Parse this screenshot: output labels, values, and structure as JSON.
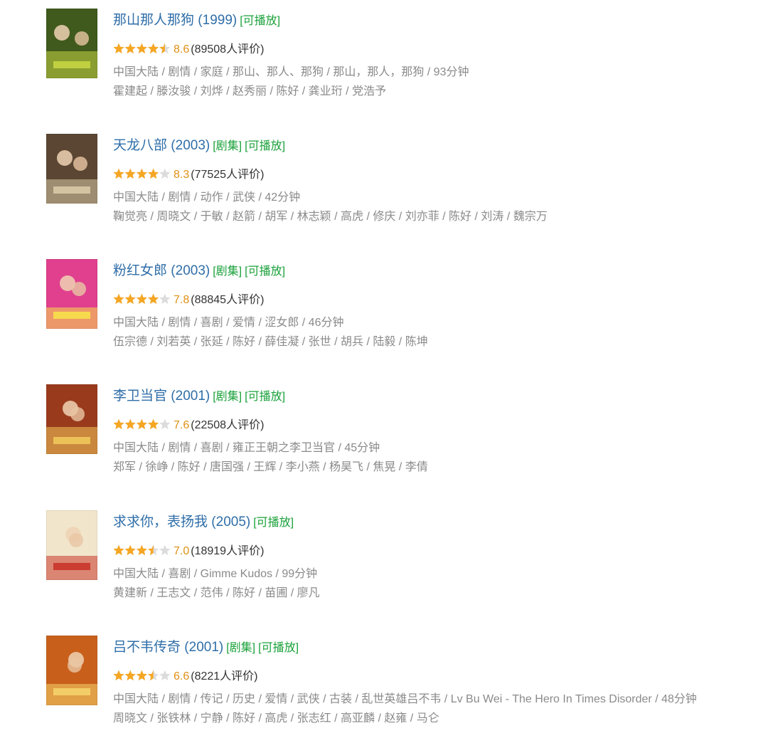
{
  "movies": [
    {
      "title": "那山那人那狗",
      "year": "(1999)",
      "tags": [
        "[可播放]"
      ],
      "rating": 4.5,
      "score": "8.6",
      "votes": "(89508人评价)",
      "meta": "中国大陆 / 剧情 / 家庭 / 那山、那人、那狗 / 那山，那人，那狗 / 93分钟",
      "cast": "霍建起 / 滕汝骏 / 刘烨 / 赵秀丽 / 陈好 / 龚业珩 / 党浩予",
      "poster": {
        "bg": "#3f5a1c",
        "accent": "#c7d642",
        "icon": "movie-poster"
      }
    },
    {
      "title": "天龙八部",
      "year": "(2003)",
      "tags": [
        "[剧集]",
        "[可播放]"
      ],
      "rating": 4,
      "score": "8.3",
      "votes": "(77525人评价)",
      "meta": "中国大陆 / 剧情 / 动作 / 武侠 / 42分钟",
      "cast": "鞠觉亮 / 周晓文 / 于敏 / 赵箭 / 胡军 / 林志颖 / 高虎 / 修庆 / 刘亦菲 / 陈好 / 刘涛 / 魏宗万",
      "poster": {
        "bg": "#5a4632",
        "accent": "#d8c9a6",
        "icon": "movie-poster"
      }
    },
    {
      "title": "粉红女郎",
      "year": "(2003)",
      "tags": [
        "[剧集]",
        "[可播放]"
      ],
      "rating": 4,
      "score": "7.8",
      "votes": "(88845人评价)",
      "meta": "中国大陆 / 剧情 / 喜剧 / 爱情 / 涩女郎 / 46分钟",
      "cast": "伍宗德 / 刘若英 / 张延 / 陈好 / 薛佳凝 / 张世 / 胡兵 / 陆毅 / 陈坤",
      "poster": {
        "bg": "#e0408e",
        "accent": "#f7e04a",
        "icon": "movie-poster"
      }
    },
    {
      "title": "李卫当官",
      "year": "(2001)",
      "tags": [
        "[剧集]",
        "[可播放]"
      ],
      "rating": 4,
      "score": "7.6",
      "votes": "(22508人评价)",
      "meta": "中国大陆 / 剧情 / 喜剧 / 雍正王朝之李卫当官 / 45分钟",
      "cast": "郑军 / 徐峥 / 陈好 / 唐国强 / 王辉 / 李小燕 / 杨昊飞 / 焦晃 / 李倩",
      "poster": {
        "bg": "#9a3a1c",
        "accent": "#f0c85a",
        "icon": "movie-poster"
      }
    },
    {
      "title": "求求你，表扬我",
      "year": "(2005)",
      "tags": [
        "[可播放]"
      ],
      "rating": 3.5,
      "score": "7.0",
      "votes": "(18919人评价)",
      "meta": "中国大陆 / 喜剧 / Gimme Kudos / 99分钟",
      "cast": "黄建新 / 王志文 / 范伟 / 陈好 / 苗圃 / 廖凡",
      "poster": {
        "bg": "#f1e6cc",
        "accent": "#c9342a",
        "icon": "movie-poster"
      }
    },
    {
      "title": "吕不韦传奇",
      "year": "(2001)",
      "tags": [
        "[剧集]",
        "[可播放]"
      ],
      "rating": 3.5,
      "score": "6.6",
      "votes": "(8221人评价)",
      "meta": "中国大陆 / 剧情 / 传记 / 历史 / 爱情 / 武侠 / 古装 / 乱世英雄吕不韦 / Lv Bu Wei - The Hero In Times Disorder / 48分钟",
      "cast": "周晓文 / 张铁林 / 宁静 / 陈好 / 高虎 / 张志红 / 高亚麟 / 赵雍 / 马仑",
      "poster": {
        "bg": "#c8601c",
        "accent": "#f5d36a",
        "icon": "movie-poster"
      }
    }
  ],
  "colors": {
    "title": "#2f6ea8",
    "playable_tag": "#1aa13a",
    "star": "#f5a623",
    "star_empty": "#dcdcdc",
    "score": "#e09015",
    "meta": "#8a8a8a"
  }
}
